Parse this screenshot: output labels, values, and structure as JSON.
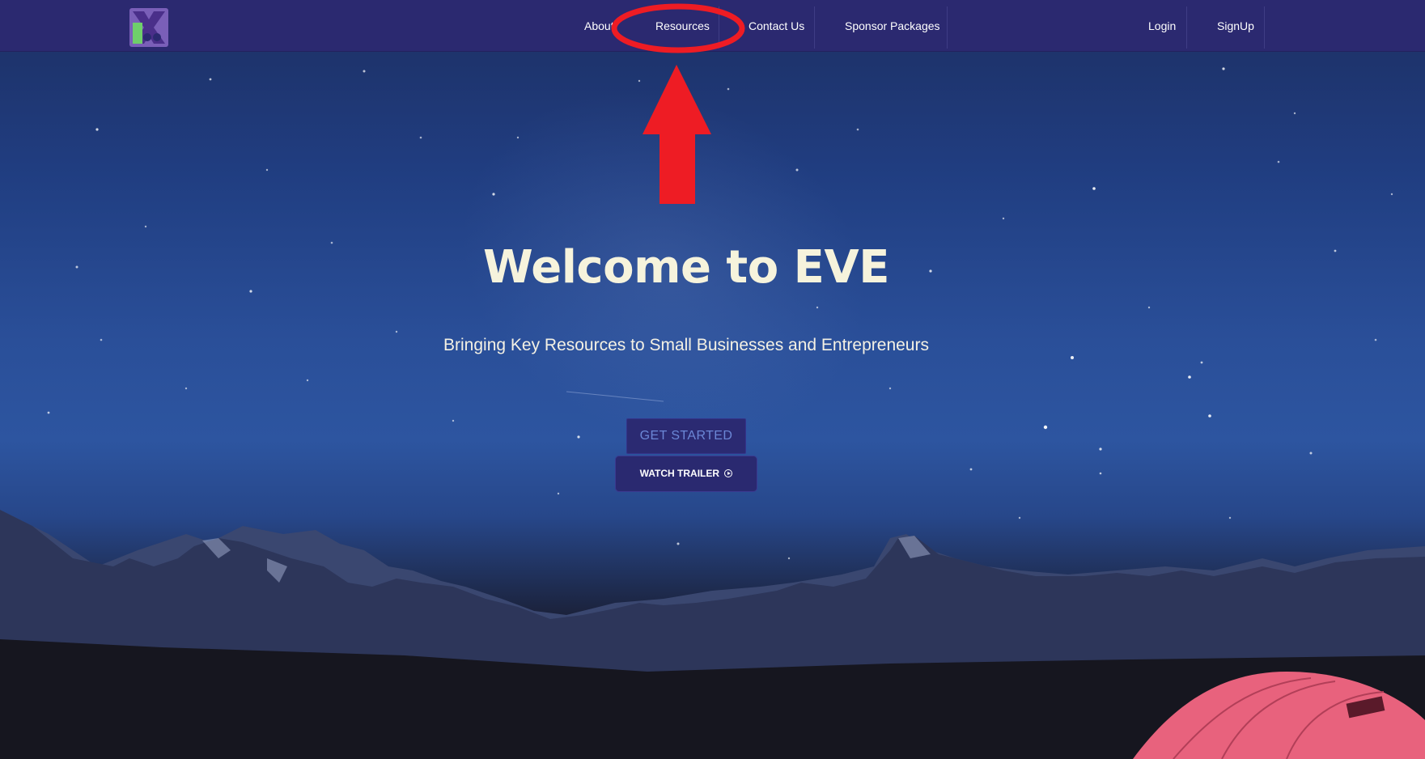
{
  "nav": {
    "logo_icon": "eve-logo-icon",
    "items": [
      {
        "label": "About"
      },
      {
        "label": "Resources"
      },
      {
        "label": "Contact Us"
      },
      {
        "label": "Sponsor Packages"
      }
    ],
    "auth": {
      "login": "Login",
      "signup": "SignUp"
    }
  },
  "hero": {
    "title": "Welcome to EVE",
    "subtitle": "Bringing Key Resources to Small Businesses and Entrepreneurs",
    "get_started": "GET STARTED",
    "watch_trailer": "WATCH TRAILER",
    "trailer_icon": "play-circle-icon"
  },
  "annotation": {
    "shapes": [
      "ellipse-highlight",
      "arrow-up"
    ],
    "color": "#ee1c24"
  },
  "colors": {
    "navbar": "#2b2970",
    "button": "#2a2970",
    "title_text": "#f6f3dc",
    "get_started_text": "#6b87d6"
  }
}
